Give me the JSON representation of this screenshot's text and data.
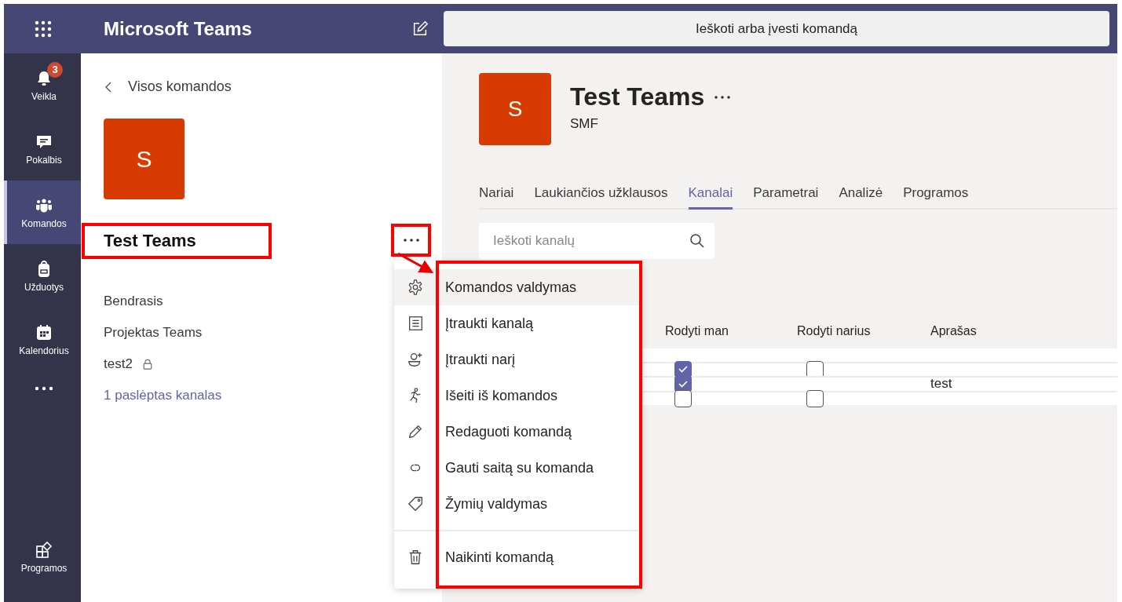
{
  "app": {
    "title": "Microsoft Teams"
  },
  "search": {
    "placeholder": "Ieškoti arba įvesti komandą"
  },
  "rail": [
    {
      "kind": "bell",
      "label": "Veikla",
      "badge": "3",
      "selected": false
    },
    {
      "kind": "chat",
      "label": "Pokalbis",
      "selected": false
    },
    {
      "kind": "teams",
      "label": "Komandos",
      "selected": true
    },
    {
      "kind": "bag",
      "label": "Užduotys",
      "selected": false
    },
    {
      "kind": "calendar",
      "label": "Kalendorius",
      "selected": false
    },
    {
      "kind": "more",
      "selected": false
    },
    {
      "kind": "apps",
      "label": "Programos",
      "selected": false
    }
  ],
  "team_panel": {
    "back": "Visos komandos",
    "avatar": "S",
    "name": "Test Teams",
    "channels": [
      {
        "name": "Bendrasis",
        "private": false
      },
      {
        "name": "Projektas Teams",
        "private": false
      },
      {
        "name": "test2",
        "private": true
      }
    ],
    "hidden_link": "1 paslėptas kanalas"
  },
  "team_header": {
    "avatar": "S",
    "title": "Test Teams",
    "subtitle": "SMF"
  },
  "tabs": [
    {
      "label": "Nariai",
      "selected": false
    },
    {
      "label": "Laukiančios užklausos",
      "selected": false
    },
    {
      "label": "Kanalai",
      "selected": true
    },
    {
      "label": "Parametrai",
      "selected": false
    },
    {
      "label": "Analizė",
      "selected": false
    },
    {
      "label": "Programos",
      "selected": false
    }
  ],
  "channel_search": {
    "placeholder": "Ieškoti kanalų"
  },
  "table": {
    "columns": [
      "Rodyti man",
      "Rodyti narius",
      "Aprašas"
    ],
    "rows": [
      {
        "kind": "blank"
      },
      {
        "kind": "channel",
        "show_for_me": true,
        "show_for_members": false
      },
      {
        "kind": "channel",
        "show_for_me": true,
        "description": "test"
      },
      {
        "kind": "channel",
        "show_for_me": false,
        "show_for_members": false
      }
    ]
  },
  "menu": {
    "sections": [
      [
        {
          "label": "Komandos valdymas",
          "selected": true
        },
        {
          "label": "Įtraukti kanalą",
          "selected": false
        },
        {
          "label": "Įtraukti narį",
          "selected": false
        },
        {
          "label": "Išeiti iš komandos",
          "selected": false
        },
        {
          "label": "Redaguoti komandą",
          "selected": false
        },
        {
          "label": "Gauti saitą su komanda",
          "selected": false
        },
        {
          "label": "Žymių valdymas",
          "selected": false
        }
      ],
      [
        {
          "label": "Naikinti komandą",
          "selected": false
        }
      ]
    ]
  }
}
